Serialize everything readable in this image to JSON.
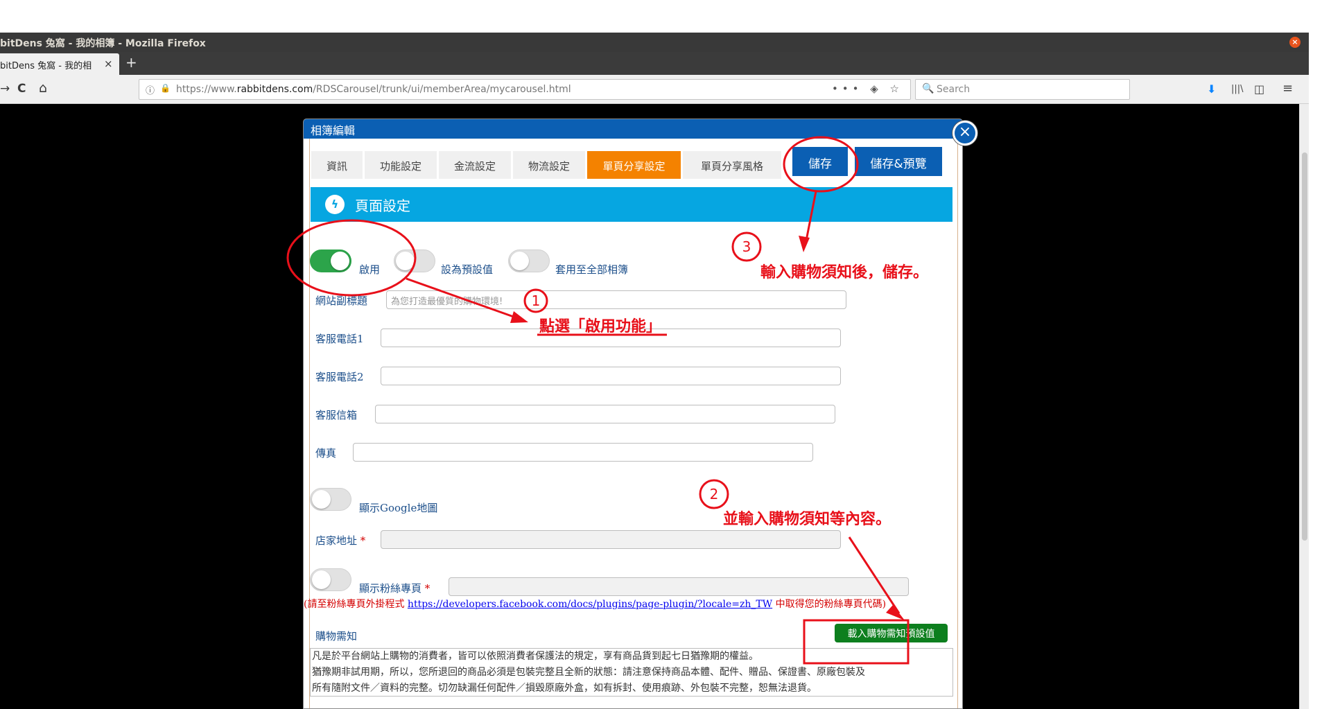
{
  "window": {
    "title": "bitDens 兔窩 - 我的相簿 - Mozilla Firefox",
    "close_glyph": "×"
  },
  "browser_tab": {
    "label": "bitDens 兔窩 - 我的相",
    "close_glyph": "×",
    "new_tab_glyph": "+"
  },
  "navbar": {
    "back_glyph": "→",
    "reload_glyph": "C",
    "home_glyph": "⌂",
    "info_glyph": "ⓘ",
    "lock_glyph": "🔒",
    "url_prefix": "https://www.",
    "url_host": "rabbitdens.com",
    "url_path": "/RDSCarousel/trunk/ui/memberArea/mycarousel.html",
    "url_actions": "••• ◈ ☆",
    "search_glyph": "🔍",
    "search_placeholder": "Search",
    "download_glyph": "⬇",
    "library_glyph": "|||\\",
    "sidebar_glyph": "◫",
    "menu_glyph": "≡"
  },
  "dialog": {
    "title": "相簿編輯",
    "close_glyph": "×",
    "tabs": [
      {
        "label": "資訊"
      },
      {
        "label": "功能設定"
      },
      {
        "label": "金流設定"
      },
      {
        "label": "物流設定"
      },
      {
        "label": "單頁分享設定"
      },
      {
        "label": "單頁分享風格"
      }
    ],
    "save_label": "儲存",
    "save_preview_label": "儲存&預覽",
    "section_title": "頁面設定",
    "section_icon": "ϟ",
    "toggles": {
      "enable": {
        "label": "啟用",
        "on": true
      },
      "default": {
        "label": "設為預設值",
        "on": false
      },
      "apply_all": {
        "label": "套用至全部相簿",
        "on": false
      },
      "google_map": {
        "label": "顯示Google地圖",
        "on": false
      },
      "fan_page": {
        "label": "顯示粉絲專頁",
        "on": false
      }
    },
    "fields": {
      "subtitle": {
        "label": "網站副標題",
        "placeholder": "為您打造最優質的購物環境!"
      },
      "phone1": {
        "label": "客服電話1",
        "value": ""
      },
      "phone2": {
        "label": "客服電話2",
        "value": ""
      },
      "email": {
        "label": "客服信箱",
        "value": ""
      },
      "fax": {
        "label": "傳真",
        "value": ""
      },
      "address": {
        "label": "店家地址",
        "value": ""
      },
      "fan_page": {
        "value": ""
      }
    },
    "required_mark": "*",
    "fb_note_prefix": "(請至粉絲專頁外掛程式 ",
    "fb_note_link": "https://developers.facebook.com/docs/plugins/page-plugin/?locale=zh_TW",
    "fb_note_suffix": " 中取得您的粉絲專頁代碼)",
    "notice_label": "購物需知",
    "load_default_label": "載入購物需知預設值",
    "notice_lines": [
      "凡是於平台網站上購物的消費者，皆可以依照消費者保護法的規定，享有商品貨到起七日猶豫期的權益。",
      "猶豫期非試用期，所以，您所退回的商品必須是包裝完整且全新的狀態：請注意保持商品本體、配件、贈品、保證書、原廠包裝及",
      "所有隨附文件／資料的完整。切勿缺漏任何配件／損毀原廠外盒，如有拆封、使用痕跡、外包裝不完整，恕無法退貨。"
    ]
  },
  "annotations": {
    "step1_number": "1",
    "step1_text": "點選「啟用功能」",
    "step2_number": "2",
    "step2_text": "並輸入購物須知等內容。",
    "step3_number": "3",
    "step3_text": "輸入購物須知後，儲存。",
    "color": "#e8101a"
  }
}
